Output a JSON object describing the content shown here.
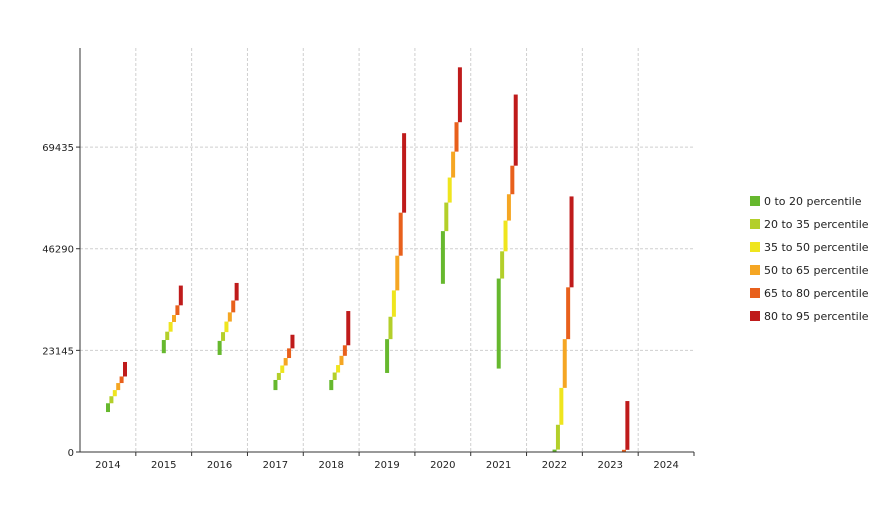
{
  "chart_data": {
    "type": "bar",
    "subtype": "floating-percentile-steps",
    "categories": [
      "2014",
      "2015",
      "2016",
      "2017",
      "2018",
      "2019",
      "2020",
      "2021",
      "2022",
      "2023",
      "2024"
    ],
    "y_ticks": [
      0,
      23145,
      46290,
      69435
    ],
    "ylim": [
      0,
      92000
    ],
    "grid": true,
    "legend_position": "right",
    "series": [
      {
        "name": "0 to 20 percentile",
        "color": "#66b82e",
        "values": [
          [
            9100,
            11100
          ],
          [
            22500,
            25500
          ],
          [
            22100,
            25300
          ],
          [
            14100,
            16400
          ],
          [
            14100,
            16400
          ],
          [
            18000,
            25700
          ],
          [
            38300,
            50300
          ],
          [
            19000,
            39500
          ],
          [
            0,
            550
          ],
          null,
          null
        ]
      },
      {
        "name": "20 to 35 percentile",
        "color": "#b3cf2a",
        "values": [
          [
            11100,
            12700
          ],
          [
            25500,
            27400
          ],
          [
            25300,
            27300
          ],
          [
            16400,
            18000
          ],
          [
            16400,
            18100
          ],
          [
            25700,
            30800
          ],
          [
            50300,
            56800
          ],
          [
            39500,
            45700
          ],
          [
            550,
            6200
          ],
          null,
          null
        ]
      },
      {
        "name": "35 to 50 percentile",
        "color": "#efe51e",
        "values": [
          [
            12700,
            14100
          ],
          [
            27400,
            29600
          ],
          [
            27300,
            29700
          ],
          [
            18000,
            19700
          ],
          [
            18100,
            19800
          ],
          [
            30800,
            36800
          ],
          [
            56800,
            62500
          ],
          [
            45700,
            52700
          ],
          [
            6200,
            14600
          ],
          null,
          null
        ]
      },
      {
        "name": "50 to 65 percentile",
        "color": "#f5a623",
        "values": [
          [
            14100,
            15700
          ],
          [
            29600,
            31200
          ],
          [
            29700,
            31800
          ],
          [
            19700,
            21400
          ],
          [
            19800,
            21900
          ],
          [
            36800,
            44700
          ],
          [
            62500,
            68400
          ],
          [
            52700,
            58700
          ],
          [
            14600,
            25700
          ],
          null,
          null
        ]
      },
      {
        "name": "65 to 80 percentile",
        "color": "#e8601c",
        "values": [
          [
            15700,
            17200
          ],
          [
            31200,
            33400
          ],
          [
            31800,
            34500
          ],
          [
            21400,
            23600
          ],
          [
            21900,
            24300
          ],
          [
            44700,
            54500
          ],
          [
            68400,
            75100
          ],
          [
            58700,
            65200
          ],
          [
            25700,
            37500
          ],
          [
            0,
            500
          ],
          null
        ]
      },
      {
        "name": "80 to 95 percentile",
        "color": "#bf1b1b",
        "values": [
          [
            17200,
            20500
          ],
          [
            33400,
            37900
          ],
          [
            34500,
            38500
          ],
          [
            23600,
            26700
          ],
          [
            24300,
            32100
          ],
          [
            54500,
            72600
          ],
          [
            75100,
            87600
          ],
          [
            65200,
            81400
          ],
          [
            37500,
            58200
          ],
          [
            500,
            11600
          ],
          null
        ]
      }
    ]
  }
}
